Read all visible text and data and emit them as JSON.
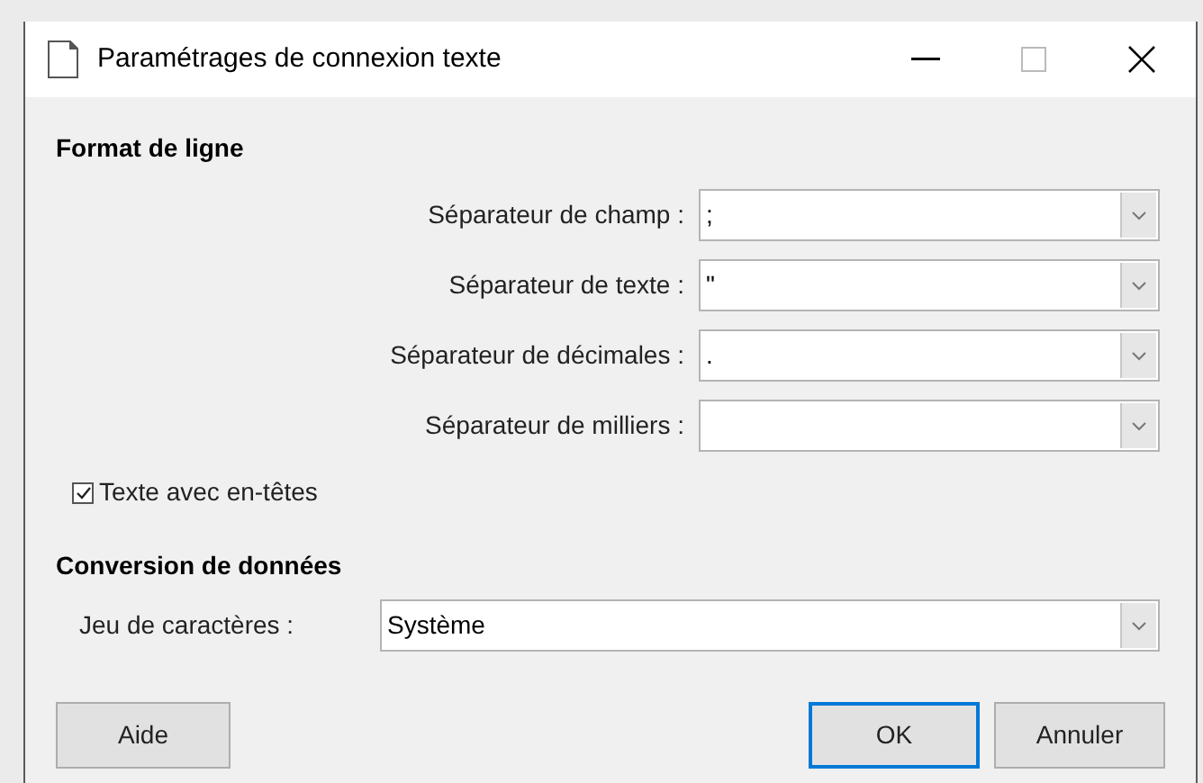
{
  "window": {
    "title": "Paramétrages de connexion texte"
  },
  "sections": [
    {
      "title": "Format de ligne",
      "fields": [
        {
          "label": "Séparateur de champ :",
          "value": ";"
        },
        {
          "label": "Séparateur de texte :",
          "value": "\""
        },
        {
          "label": "Séparateur de décimales :",
          "value": "."
        },
        {
          "label": "Séparateur de milliers :"
        }
      ],
      "checkbox": {
        "label": "Texte avec en-têtes",
        "checked": true
      }
    },
    {
      "title": "Conversion de données",
      "fields": [
        {
          "label": "Jeu de caractères :",
          "value": "Système"
        }
      ]
    }
  ],
  "buttons": [
    {
      "label": "Aide",
      "default": false
    },
    {
      "label": "OK",
      "default": true
    },
    {
      "label": "Annuler",
      "default": false
    }
  ]
}
